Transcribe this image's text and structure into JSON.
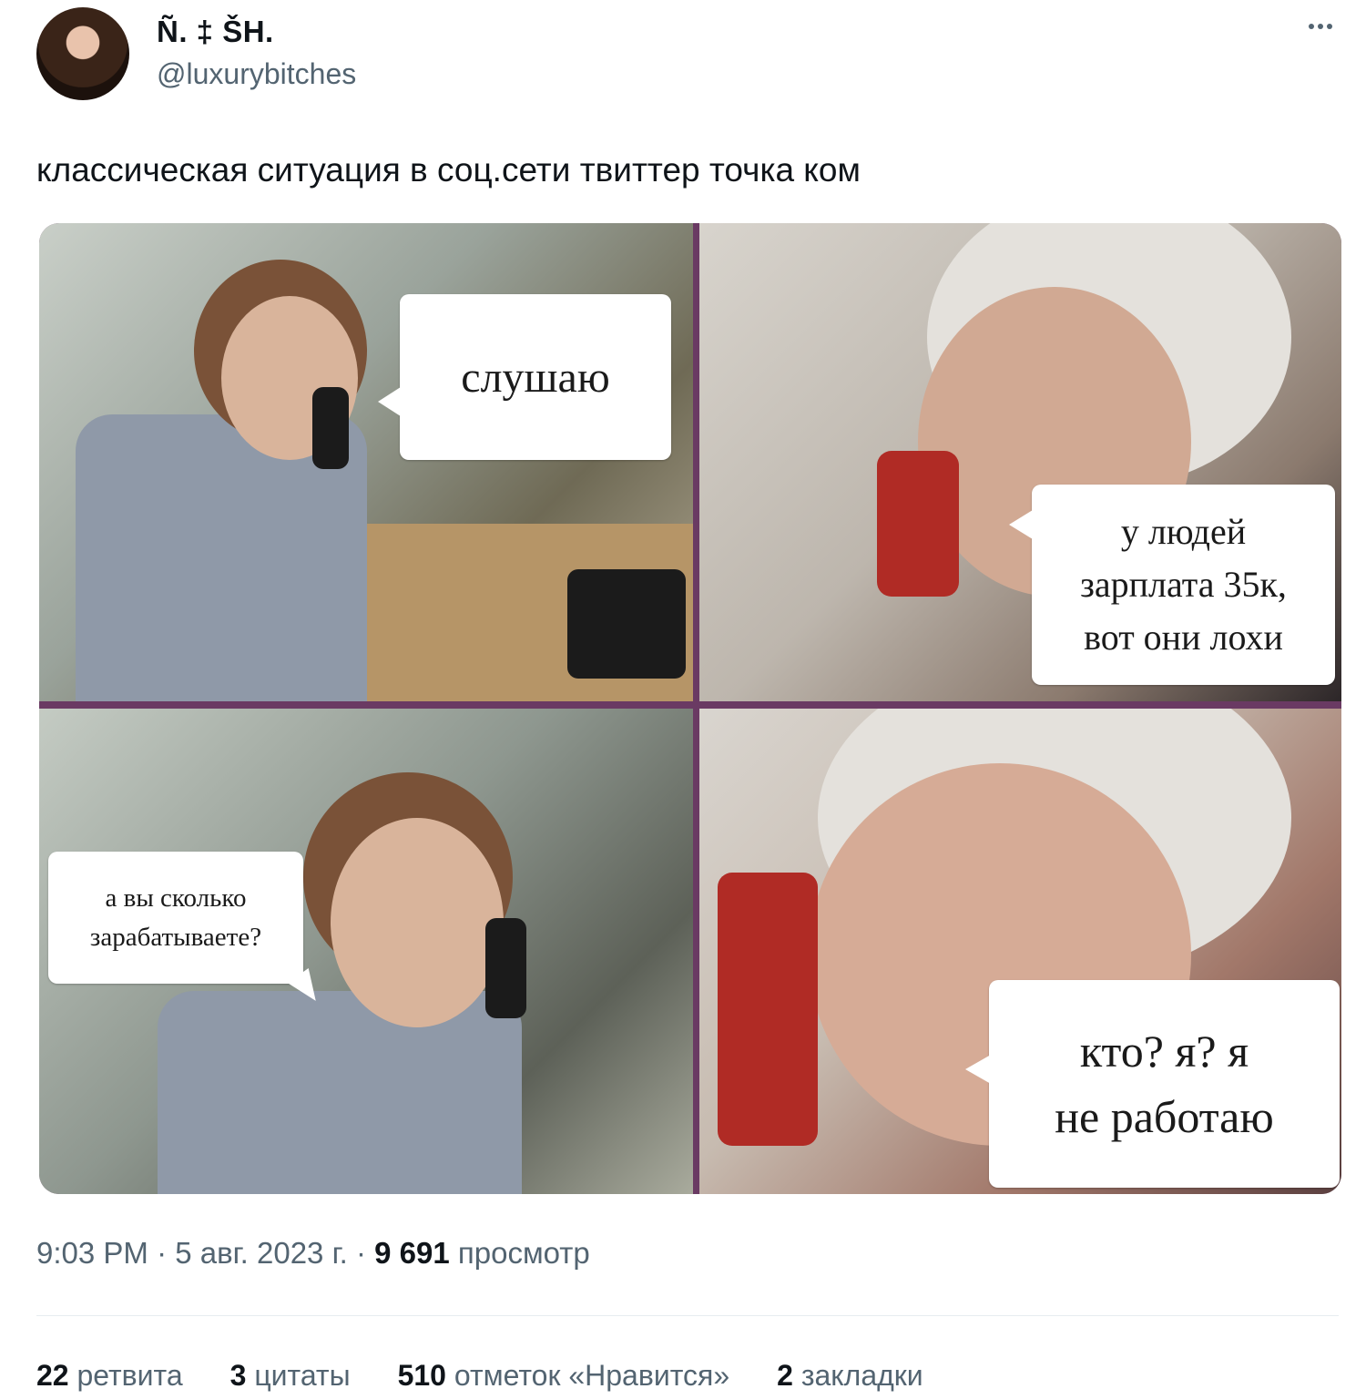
{
  "author": {
    "display_name": "Ñ. ‡ ŠH.",
    "handle": "@luxurybitches"
  },
  "tweet": {
    "text": "классическая ситуация в соц.сети твиттер точка ком"
  },
  "media": {
    "bubble_1": "слушаю",
    "bubble_2_lines": [
      "у людей",
      "зарплата 35к,",
      "вот они лохи"
    ],
    "bubble_3_lines": [
      "а вы сколько",
      "зарабатываете?"
    ],
    "bubble_4_lines": [
      "кто? я? я",
      "не работаю"
    ]
  },
  "meta": {
    "time": "9:03 PM",
    "separator": "·",
    "date": "5 авг. 2023 г.",
    "views_count": "9 691",
    "views_label": "просмотр"
  },
  "stats": {
    "retweets": {
      "count": "22",
      "label": "ретвита"
    },
    "quotes": {
      "count": "3",
      "label": "цитаты"
    },
    "likes": {
      "count": "510",
      "label": "отметок «Нравится»"
    },
    "bookmarks": {
      "count": "2",
      "label": "закладки"
    }
  },
  "icons": {
    "more": "more-horizontal-icon"
  },
  "colors": {
    "text_primary": "#0f1419",
    "text_secondary": "#536471",
    "divider": "#e6ecf0",
    "meme_border": "#6a3a63"
  }
}
